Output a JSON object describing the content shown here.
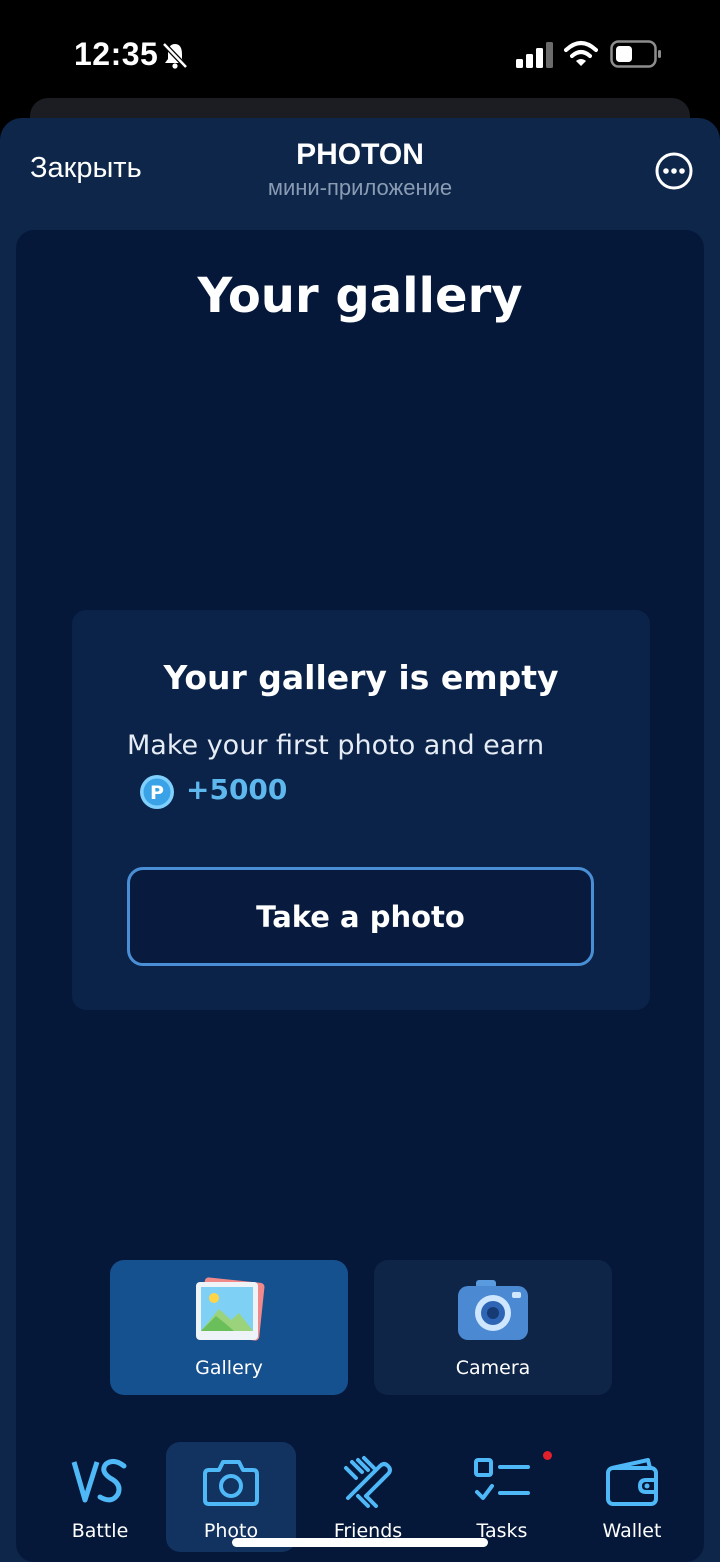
{
  "status_bar": {
    "time": "12:35",
    "icons": [
      "bell-slash-icon",
      "cellular-signal-icon",
      "wifi-icon",
      "battery-icon"
    ]
  },
  "header": {
    "close_label": "Закрыть",
    "title": "PHOTON",
    "subtitle": "мини-приложение",
    "more_icon": "ellipsis-circle-icon"
  },
  "main": {
    "title": "Your gallery",
    "empty_state": {
      "title": "Your gallery is empty",
      "description": "Make your first photo and earn",
      "reward_amount": "+5000",
      "reward_icon": "photon-coin-icon",
      "button_label": "Take a photo"
    }
  },
  "view_switch": [
    {
      "label": "Gallery",
      "icon": "gallery-icon",
      "active": true
    },
    {
      "label": "Camera",
      "icon": "camera-icon",
      "active": false
    }
  ],
  "bottom_nav": [
    {
      "label": "Battle",
      "icon": "vs-icon",
      "active": false
    },
    {
      "label": "Photo",
      "icon": "camera-outline-icon",
      "active": true
    },
    {
      "label": "Friends",
      "icon": "handshake-icon",
      "active": false
    },
    {
      "label": "Tasks",
      "icon": "checklist-icon",
      "active": false,
      "has_notification": true
    },
    {
      "label": "Wallet",
      "icon": "wallet-icon",
      "active": false
    }
  ],
  "colors": {
    "sheet_bg": "#0d2649",
    "content_bg": "#06183a",
    "accent": "#4fb8f7",
    "active_tab": "#15508f",
    "notification": "#e0202a"
  }
}
